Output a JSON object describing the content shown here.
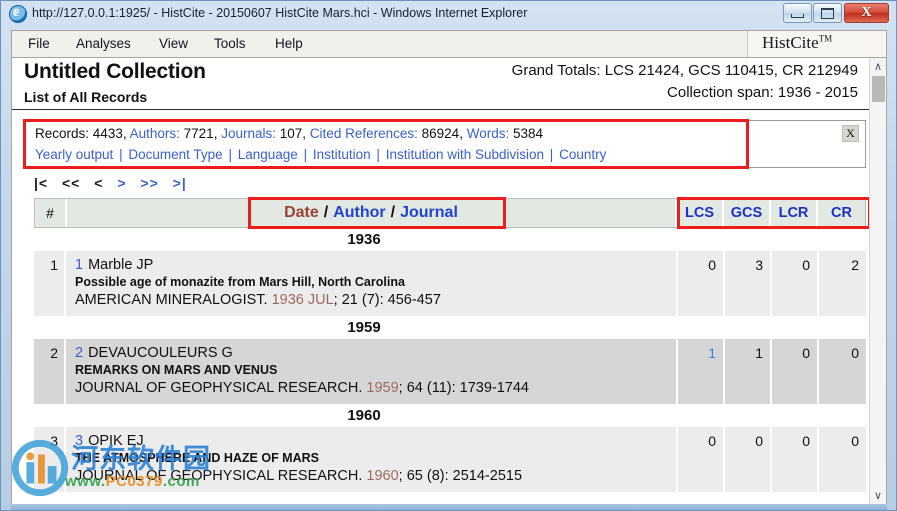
{
  "window": {
    "title": "http://127.0.0.1:1925/ - HistCite - 20150607 HistCite Mars.hci - Windows Internet Explorer",
    "icon": "internet-explorer-icon",
    "buttons": {
      "minimize": "minimize",
      "maximize": "maximize",
      "close": "X"
    }
  },
  "menubar": {
    "items": [
      {
        "label": "File"
      },
      {
        "label": "Analyses"
      },
      {
        "label": "View"
      },
      {
        "label": "Tools"
      },
      {
        "label": "Help"
      }
    ],
    "logo": "HistCite",
    "logo_tm": "TM"
  },
  "header": {
    "collection_title": "Untitled Collection",
    "collection_subtitle": "List of All Records",
    "grand_totals": "Grand Totals: LCS 21424, GCS 110415, CR 212949",
    "collection_span": "Collection span: 1936 - 2015"
  },
  "infobox": {
    "close_label": "X",
    "stats": [
      {
        "label": "Records:",
        "value": "4433",
        "link": false
      },
      {
        "label": "Authors:",
        "value": "7721",
        "link": true
      },
      {
        "label": "Journals:",
        "value": "107",
        "link": true
      },
      {
        "label": "Cited References:",
        "value": "86924",
        "link": true
      },
      {
        "label": "Words:",
        "value": "5384",
        "link": true
      }
    ],
    "links": [
      "Yearly output",
      "Document Type",
      "Language",
      "Institution",
      "Institution with Subdivision",
      "Country"
    ],
    "separator": "|"
  },
  "pager": {
    "first": "|<",
    "prev_block": "<<",
    "prev": "<",
    "next": ">",
    "next_block": ">>",
    "last": ">|"
  },
  "table": {
    "columns": {
      "num": "#",
      "sort_date": "Date",
      "sort_author": "Author",
      "sort_journal": "Journal",
      "slash": "/",
      "scores": [
        "LCS",
        "GCS",
        "LCR",
        "CR"
      ]
    },
    "groups": [
      {
        "year": "1936",
        "records": [
          {
            "num": "1",
            "index": "1",
            "author": "Marble JP",
            "title": "Possible age of monazite from Mars Hill, North Carolina",
            "journal": "AMERICAN MINERALOGIST.",
            "date": "1936 JUL",
            "citation": "; 21 (7): 456-457",
            "scores": [
              "0",
              "3",
              "0",
              "2"
            ],
            "score_links": [
              false,
              false,
              false,
              false
            ],
            "alt": false
          }
        ]
      },
      {
        "year": "1959",
        "records": [
          {
            "num": "2",
            "index": "2",
            "author": "DEVAUCOULEURS G",
            "title": "REMARKS ON MARS AND VENUS",
            "journal": "JOURNAL OF GEOPHYSICAL RESEARCH.",
            "date": "1959",
            "citation": "; 64 (11): 1739-1744",
            "scores": [
              "1",
              "1",
              "0",
              "0"
            ],
            "score_links": [
              true,
              false,
              false,
              false
            ],
            "alt": true
          }
        ]
      },
      {
        "year": "1960",
        "records": [
          {
            "num": "3",
            "index": "3",
            "author": "OPIK EJ",
            "title": "THE ATMOSPHERE AND HAZE OF MARS",
            "journal": "JOURNAL OF GEOPHYSICAL RESEARCH.",
            "date": "1960",
            "citation": "; 65 (8): 2514-2515",
            "scores": [
              "0",
              "0",
              "0",
              "0"
            ],
            "score_links": [
              false,
              false,
              false,
              false
            ],
            "alt": false
          }
        ]
      }
    ]
  },
  "scrollbar": {
    "up": "∧",
    "down": "∨"
  },
  "watermark": {
    "cn": "河东软件园",
    "url_w": "www.",
    "url_pc": "PC0379",
    "url_com": ".com"
  },
  "colors": {
    "accent_red": "#ee1c1c",
    "link_blue": "#3a5fcd",
    "score_blue": "#1f2fc8",
    "date_brown": "#9a4436"
  }
}
